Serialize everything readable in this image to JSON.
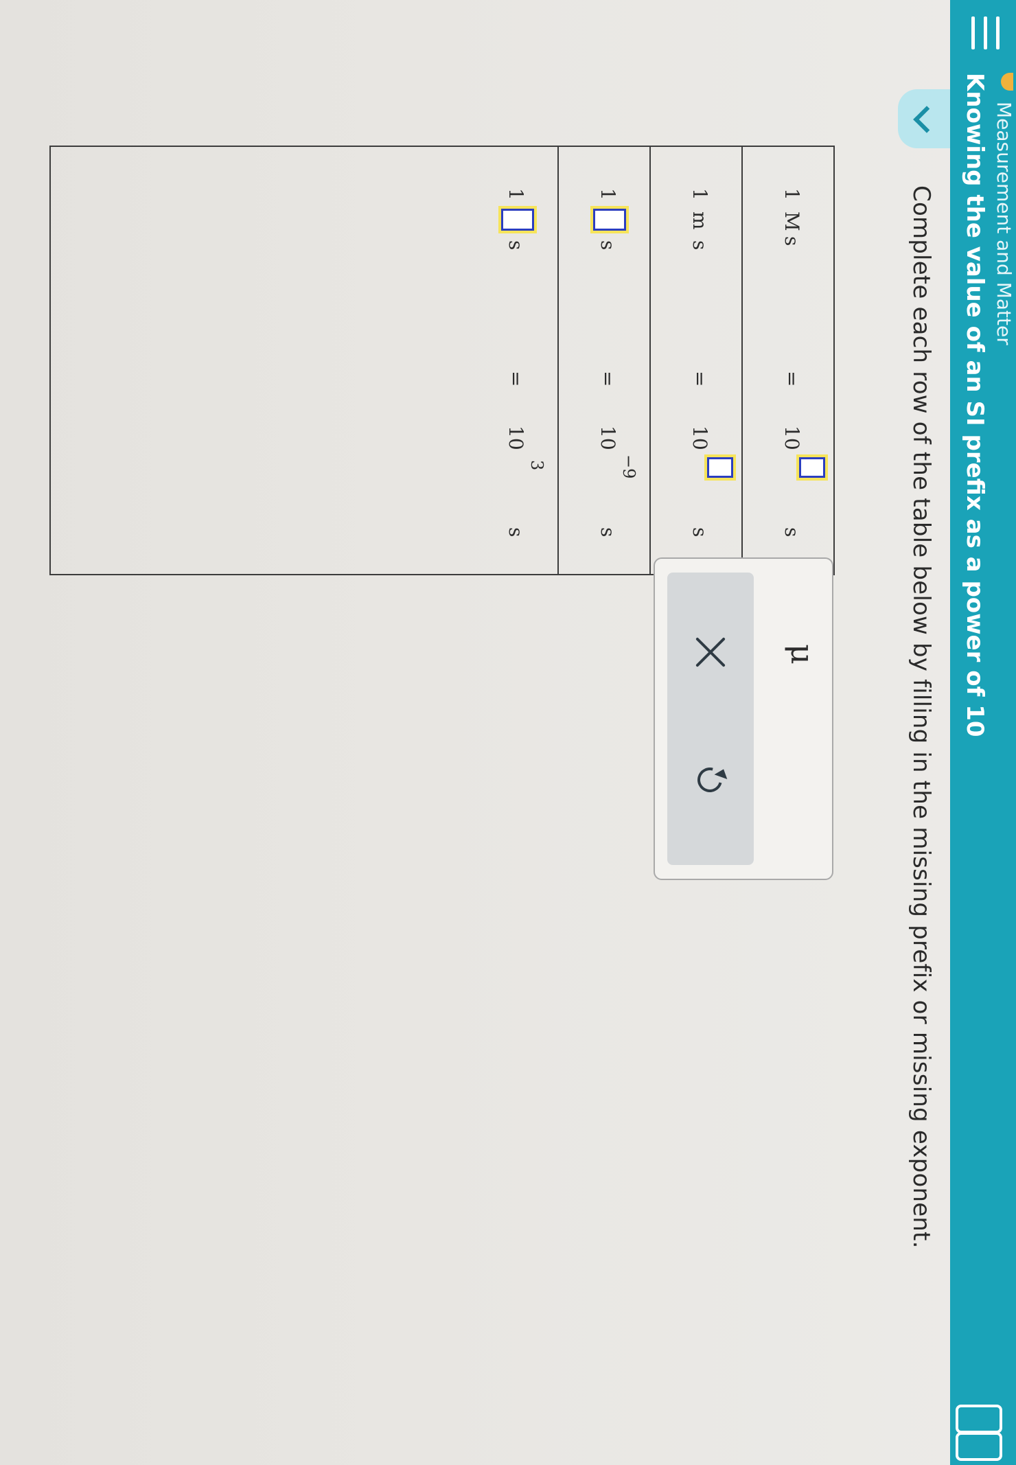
{
  "header": {
    "breadcrumb": "Measurement and Matter",
    "title": "Knowing the value of an SI prefix as a power of 10"
  },
  "instruction": "Complete each row of the table below by filling in the missing prefix or missing exponent.",
  "table": {
    "rows": [
      {
        "left_value": "1",
        "left_prefix": "M",
        "left_unit": "s",
        "equals": "=",
        "base": "10",
        "exponent": "",
        "right_unit": "s",
        "missing": "exponent"
      },
      {
        "left_value": "1",
        "left_prefix": "m",
        "left_unit": "s",
        "equals": "=",
        "base": "10",
        "exponent": "",
        "right_unit": "s",
        "missing": "exponent"
      },
      {
        "left_value": "1",
        "left_prefix": "",
        "left_unit": "s",
        "equals": "=",
        "base": "10",
        "exponent": "−9",
        "right_unit": "s",
        "missing": "prefix"
      },
      {
        "left_value": "1",
        "left_prefix": "",
        "left_unit": "s",
        "equals": "=",
        "base": "10",
        "exponent": "3",
        "right_unit": "s",
        "missing": "prefix"
      }
    ]
  },
  "palette": {
    "symbol": "μ",
    "clear_icon": "x-icon",
    "undo_icon": "undo-icon"
  },
  "colors": {
    "header_teal": "#1aa3b8",
    "answer_highlight": "#f6e45a",
    "answer_border": "#2b3ec0"
  }
}
